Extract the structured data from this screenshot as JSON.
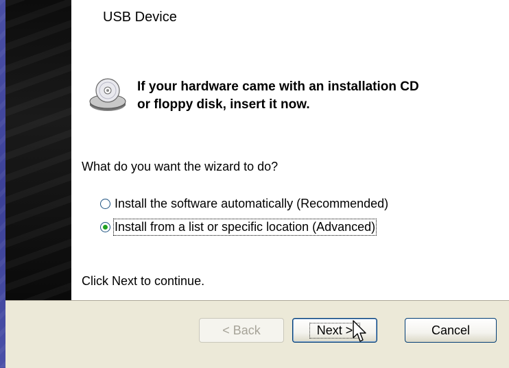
{
  "window": {
    "device_name": "USB Device"
  },
  "prompt": {
    "line1": "If your hardware came with an installation CD",
    "line2": "or floppy disk, insert it now."
  },
  "question": "What do you want the wizard to do?",
  "options": [
    {
      "label": "Install the software automatically (Recommended)",
      "selected": false
    },
    {
      "label": "Install from a list or specific location (Advanced)",
      "selected": true
    }
  ],
  "instruction": "Click Next to continue.",
  "buttons": {
    "back": "< Back",
    "next": "Next >",
    "cancel": "Cancel"
  },
  "icons": {
    "cd": "cd-drive-icon",
    "cursor": "mouse-pointer-icon"
  }
}
